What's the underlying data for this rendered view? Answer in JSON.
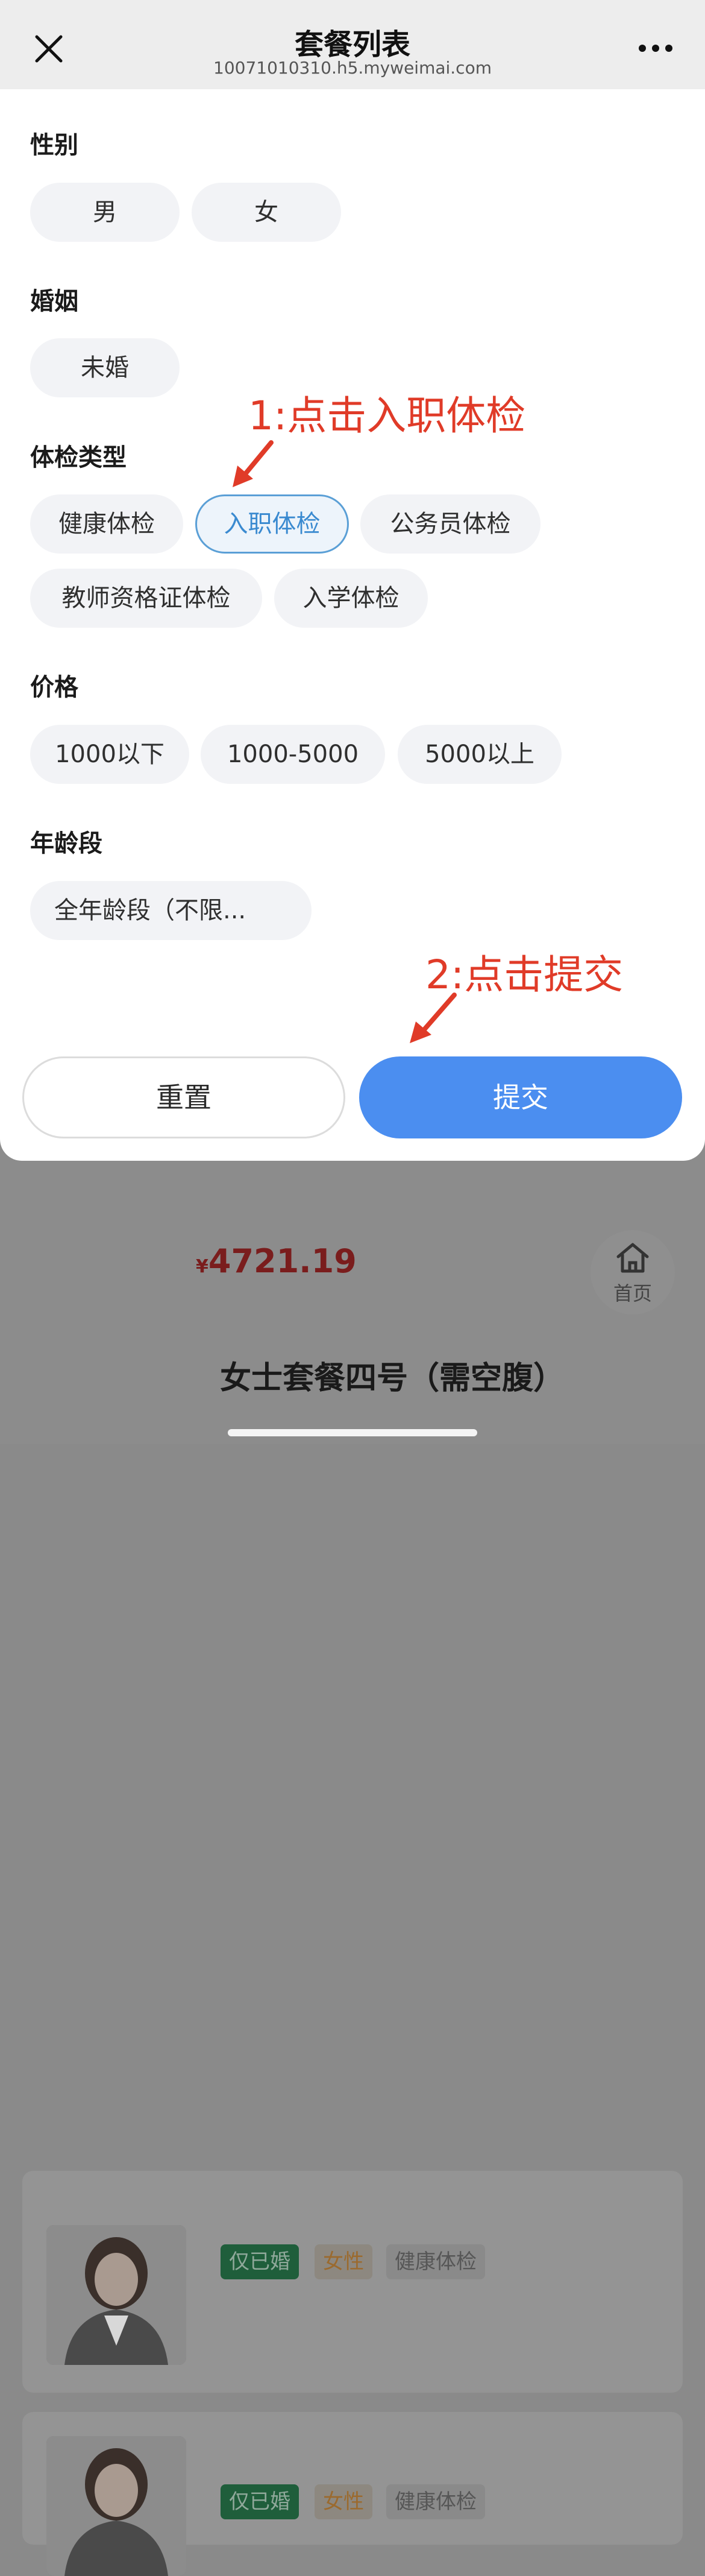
{
  "topbar": {
    "title": "套餐列表",
    "url": "10071010310.h5.myweimai.com"
  },
  "filters": {
    "gender": {
      "label": "性别",
      "options": [
        "男",
        "女"
      ]
    },
    "marriage": {
      "label": "婚姻",
      "options": [
        "未婚"
      ]
    },
    "exam_type": {
      "label": "体检类型",
      "options": [
        "健康体检",
        "入职体检",
        "公务员体检",
        "教师资格证体检",
        "入学体检"
      ],
      "selected": "入职体检"
    },
    "price": {
      "label": "价格",
      "options": [
        "1000以下",
        "1000-5000",
        "5000以上"
      ]
    },
    "age": {
      "label": "年龄段",
      "options": [
        "全年龄段（不限..."
      ]
    }
  },
  "annotations": {
    "step1": "1:点击入职体检",
    "step2": "2:点击提交",
    "color": "#e03b28"
  },
  "actions": {
    "reset": "重置",
    "submit": "提交"
  },
  "background_list": {
    "card1": {
      "tags": [
        "仅已婚",
        "女性",
        "健康体检"
      ],
      "price_symbol": "¥",
      "price": "4721.19"
    },
    "card2": {
      "title": "女士套餐四号（需空腹）",
      "tags": [
        "仅已婚",
        "女性",
        "健康体检"
      ]
    }
  },
  "home_button": {
    "label": "首页"
  },
  "colors": {
    "accent": "#4b8ef0",
    "selected_border": "#5a9fd6",
    "price": "#d0302a"
  }
}
